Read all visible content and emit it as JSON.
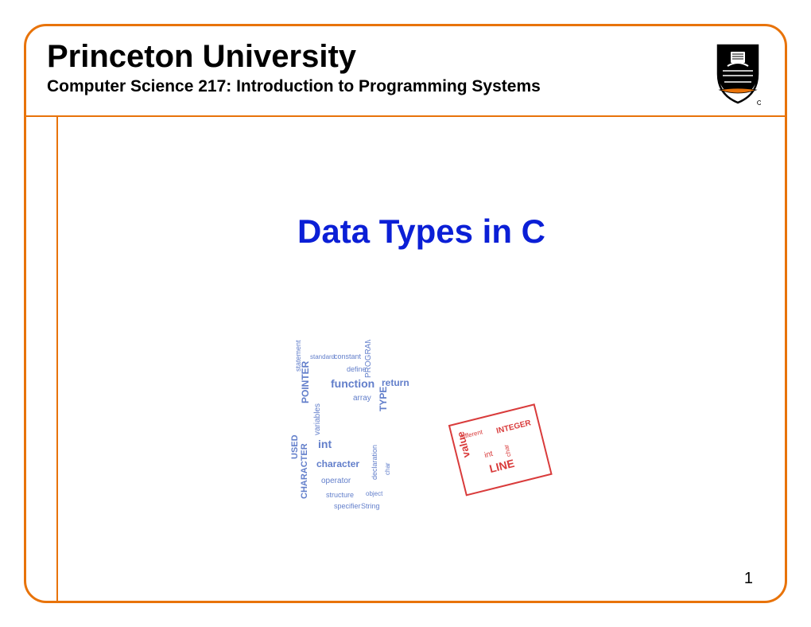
{
  "header": {
    "institution": "Princeton University",
    "course": "Computer Science 217: Introduction to Programming Systems"
  },
  "slide": {
    "title": "Data Types in C",
    "page_number": "1"
  },
  "shield": {
    "semantic": "princeton-shield-logo"
  },
  "wordcloud": {
    "blue_words": [
      "POINTER",
      "function",
      "variables",
      "array",
      "return",
      "TYPE",
      "PROGRAM",
      "int",
      "character",
      "char",
      "CHARACTER",
      "statement",
      "constant",
      "define",
      "operator",
      "structure",
      "string",
      "specifier",
      "USED",
      "object",
      "declaration",
      "standard"
    ],
    "red_words": [
      "value",
      "INTEGER",
      "int",
      "LINE",
      "different"
    ]
  }
}
